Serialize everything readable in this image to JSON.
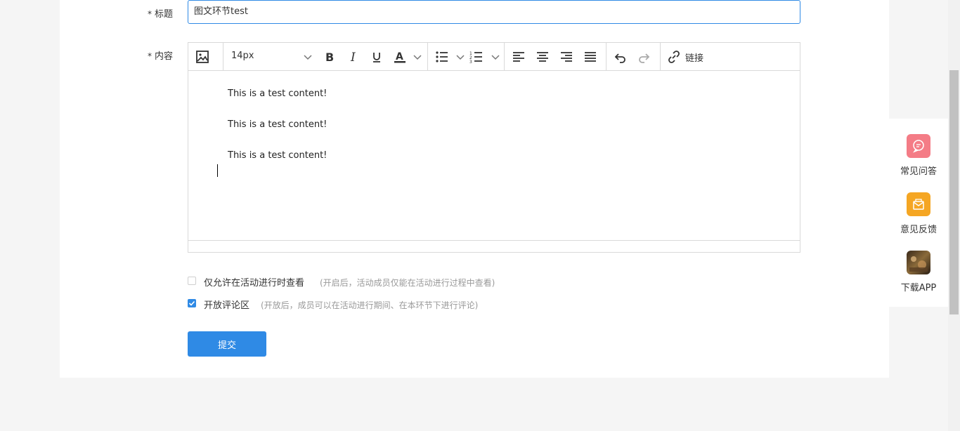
{
  "form": {
    "title_label": "标题",
    "title_value": "图文环节test",
    "content_label": "内容",
    "required_mark": "*"
  },
  "toolbar": {
    "font_size": "14px",
    "link_label": "链接",
    "icons": [
      "image-icon",
      "bold-icon",
      "italic-icon",
      "underline-icon",
      "font-color-icon",
      "bullet-list-icon",
      "numbered-list-icon",
      "align-left-icon",
      "align-center-icon",
      "align-right-icon",
      "justify-icon",
      "undo-icon",
      "redo-icon",
      "link-icon"
    ]
  },
  "editor": {
    "lines": [
      "This is a test content!",
      "This is a test content!",
      "This is a test content!"
    ]
  },
  "options": [
    {
      "label": "仅允许在活动进行时查看",
      "hint": "(开启后，活动成员仅能在活动进行过程中查看)",
      "checked": false
    },
    {
      "label": "开放评论区",
      "hint": "(开放后，成员可以在活动进行期间、在本环节下进行评论)",
      "checked": true
    }
  ],
  "submit_label": "提交",
  "side_panel": {
    "items": [
      {
        "label": "常见问答",
        "icon": "faq-chat-icon",
        "color": "#f47c86"
      },
      {
        "label": "意见反馈",
        "icon": "feedback-mail-icon",
        "color": "#f5a623"
      },
      {
        "label": "下载APP",
        "icon": "app-thumbnail-icon",
        "color": "#6b4a2a"
      }
    ]
  },
  "colors": {
    "accent": "#2f8ae5",
    "page_bg": "#f5f5f5"
  }
}
